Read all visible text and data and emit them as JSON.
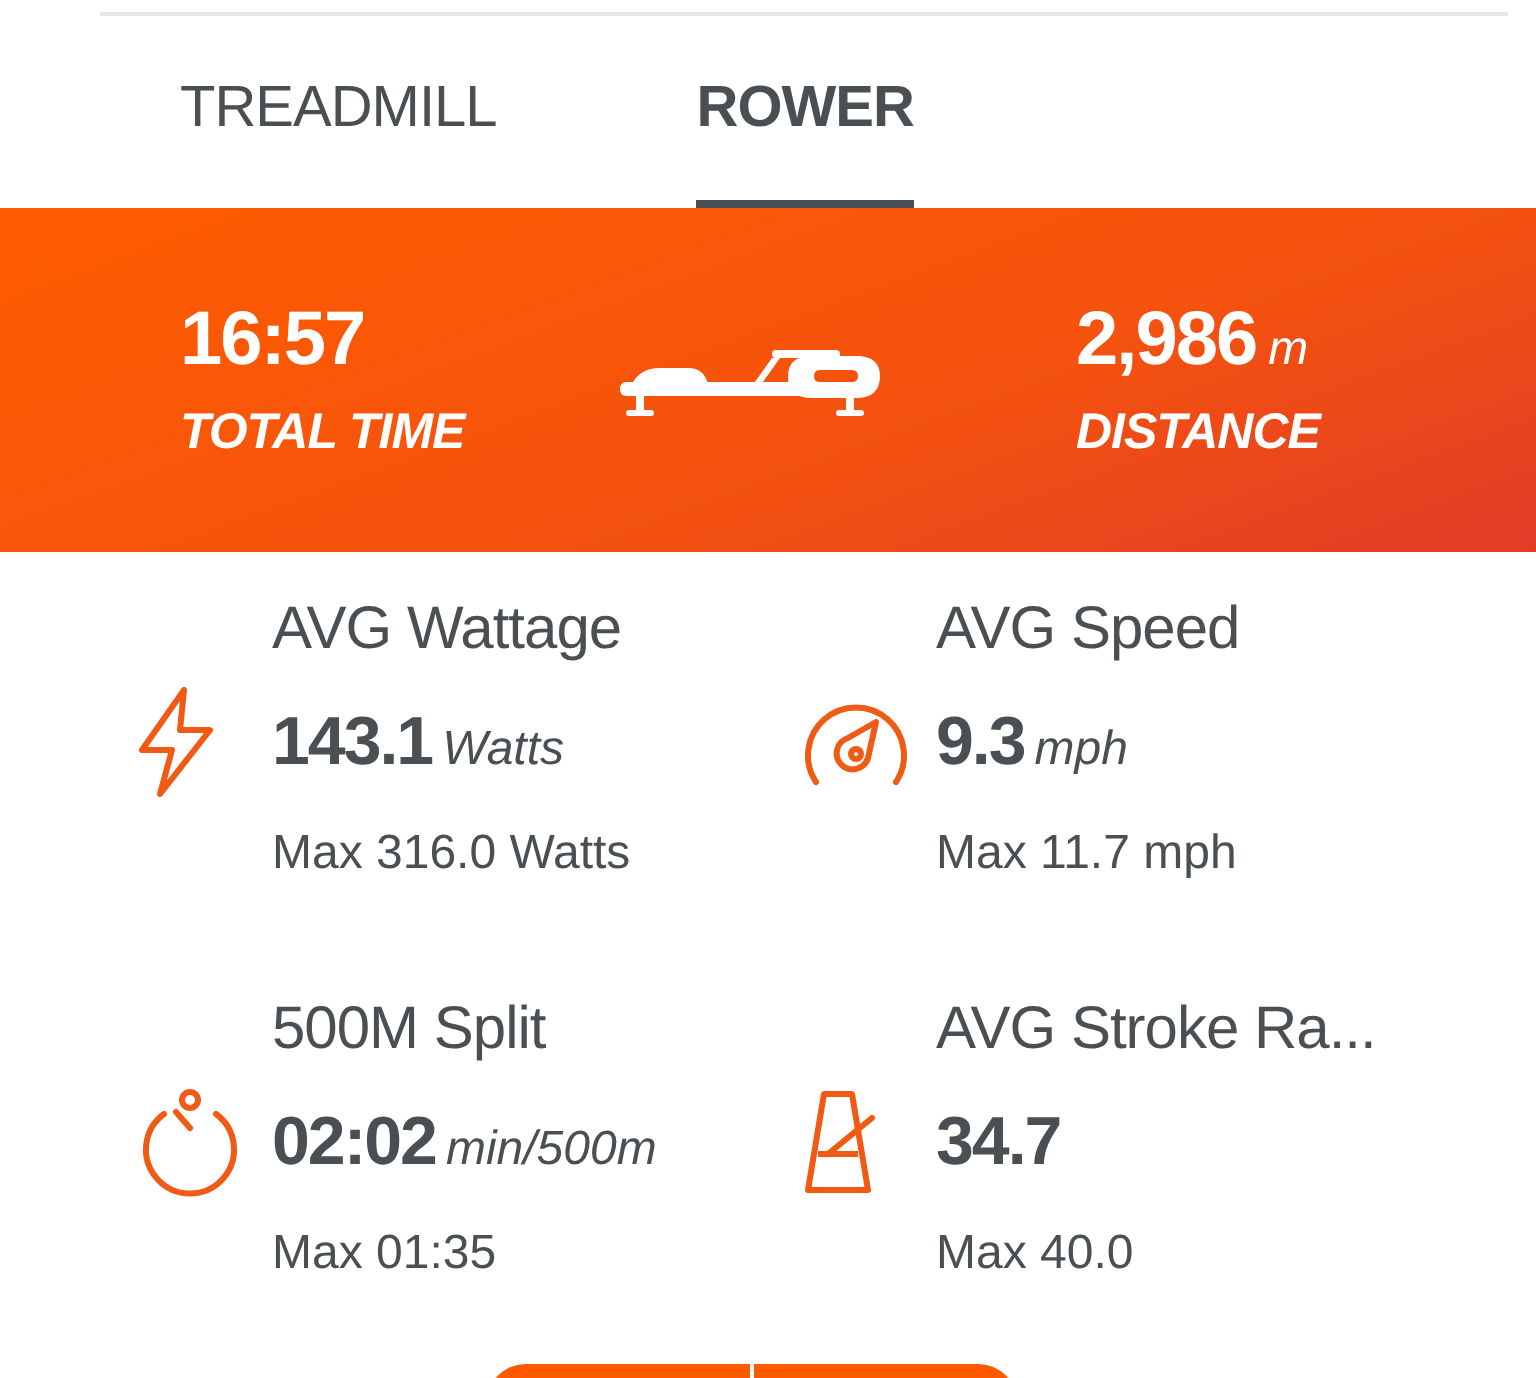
{
  "tabs": [
    {
      "label": "TREADMILL",
      "selected": false
    },
    {
      "label": "ROWER",
      "selected": true
    }
  ],
  "summary": {
    "time": {
      "value": "16:57",
      "label": "TOTAL TIME"
    },
    "distance": {
      "value": "2,986",
      "unit": "m",
      "label": "DISTANCE"
    }
  },
  "stats": [
    {
      "label": "AVG Wattage",
      "value": "143.1",
      "unit": "Watts",
      "max": "Max 316.0 Watts"
    },
    {
      "label": "AVG Speed",
      "value": "9.3",
      "unit": "mph",
      "max": "Max 11.7 mph"
    },
    {
      "label": "500M Split",
      "value": "02:02",
      "unit": "min/500m",
      "max": "Max 01:35"
    },
    {
      "label": "AVG Stroke Ra...",
      "value": "34.7",
      "max": "Max 40.0"
    }
  ]
}
